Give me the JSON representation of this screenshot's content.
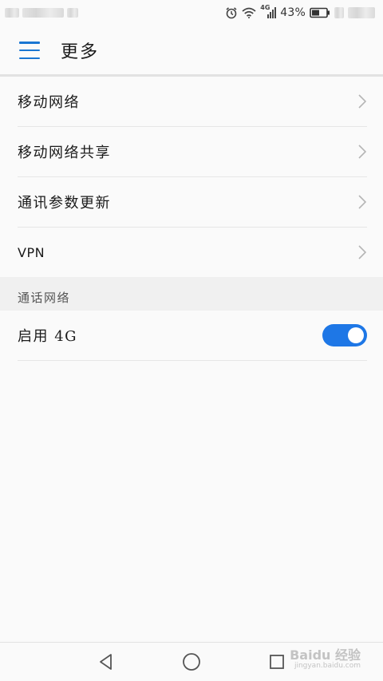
{
  "status_bar": {
    "battery_percent": "43%",
    "network_type": "4G",
    "icons": [
      "alarm-icon",
      "wifi-icon",
      "signal-icon",
      "battery-icon"
    ]
  },
  "app_bar": {
    "title": "更多",
    "menu_icon": "hamburger-icon"
  },
  "menu_items": [
    {
      "label": "移动网络"
    },
    {
      "label": "移动网络共享"
    },
    {
      "label": "通讯参数更新"
    },
    {
      "label": "VPN"
    }
  ],
  "section": {
    "header": "通话网络",
    "toggle_item": {
      "label": "启用 4G",
      "enabled": true
    }
  },
  "nav_bar": {
    "icons": [
      "back-icon",
      "home-icon",
      "recents-icon"
    ]
  },
  "watermark": {
    "main": "Baidu 经验",
    "sub": "jingyan.baidu.com"
  },
  "colors": {
    "accent": "#1976d2",
    "toggle_on": "#1e77e6",
    "background": "#fafafa",
    "section_bg": "#f0f0f0"
  }
}
